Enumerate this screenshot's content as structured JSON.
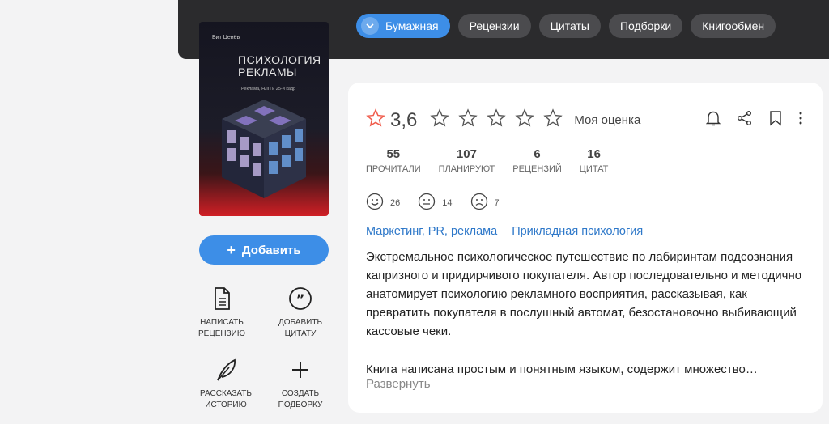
{
  "tabs": [
    {
      "label": "Бумажная",
      "active": true
    },
    {
      "label": "Рецензии"
    },
    {
      "label": "Цитаты"
    },
    {
      "label": "Подборки"
    },
    {
      "label": "Книгообмен"
    }
  ],
  "cover": {
    "author": "Вит Ценёв",
    "title_line1": "ПСИХОЛОГИЯ",
    "title_line2": "РЕКЛАМЫ",
    "subtitle": "Реклама, НЛП и 25-й кадр"
  },
  "add_button": {
    "icon": "plus-icon",
    "label": "Добавить"
  },
  "actions": {
    "review": {
      "icon": "document-icon",
      "line1": "НАПИСАТЬ",
      "line2": "РЕЦЕНЗИЮ"
    },
    "quote": {
      "icon": "quote-icon",
      "line1": "ДОБАВИТЬ",
      "line2": "ЦИТАТУ"
    },
    "story": {
      "icon": "feather-icon",
      "line1": "РАССКАЗАТЬ",
      "line2": "ИСТОРИЮ"
    },
    "collection": {
      "icon": "plus-icon",
      "line1": "СОЗДАТЬ",
      "line2": "ПОДБОРКУ"
    }
  },
  "rating": {
    "value": "3,6",
    "my_rating_label": "Моя оценка",
    "star_color": "#f05b4b",
    "max_stars": 5
  },
  "stats": [
    {
      "num": "55",
      "label": "ПРОЧИТАЛИ"
    },
    {
      "num": "107",
      "label": "ПЛАНИРУЮТ"
    },
    {
      "num": "6",
      "label": "РЕЦЕНЗИЙ"
    },
    {
      "num": "16",
      "label": "ЦИТАТ"
    }
  ],
  "moods": [
    {
      "icon": "smile-icon",
      "count": "26"
    },
    {
      "icon": "neutral-face-icon",
      "count": "14"
    },
    {
      "icon": "sad-face-icon",
      "count": "7"
    }
  ],
  "genres": [
    "Маркетинг, PR, реклама",
    "Прикладная психология"
  ],
  "description": {
    "p1": "Экстремальное психологическое путешествие по лабиринтам подсознания капризного и придирчивого покупателя. Автор последовательно и методично анатомирует психологию рекламного восприятия, рассказывая, как превратить покупателя в послушный автомат, безостановочно выбивающий кассовые чеки.",
    "p2": "Книга написана простым и понятным языком, содержит множество…",
    "expand": "Развернуть"
  },
  "colors": {
    "accent": "#3d8ee7",
    "topbar": "#2b2b2d",
    "link": "#2e78c9"
  }
}
